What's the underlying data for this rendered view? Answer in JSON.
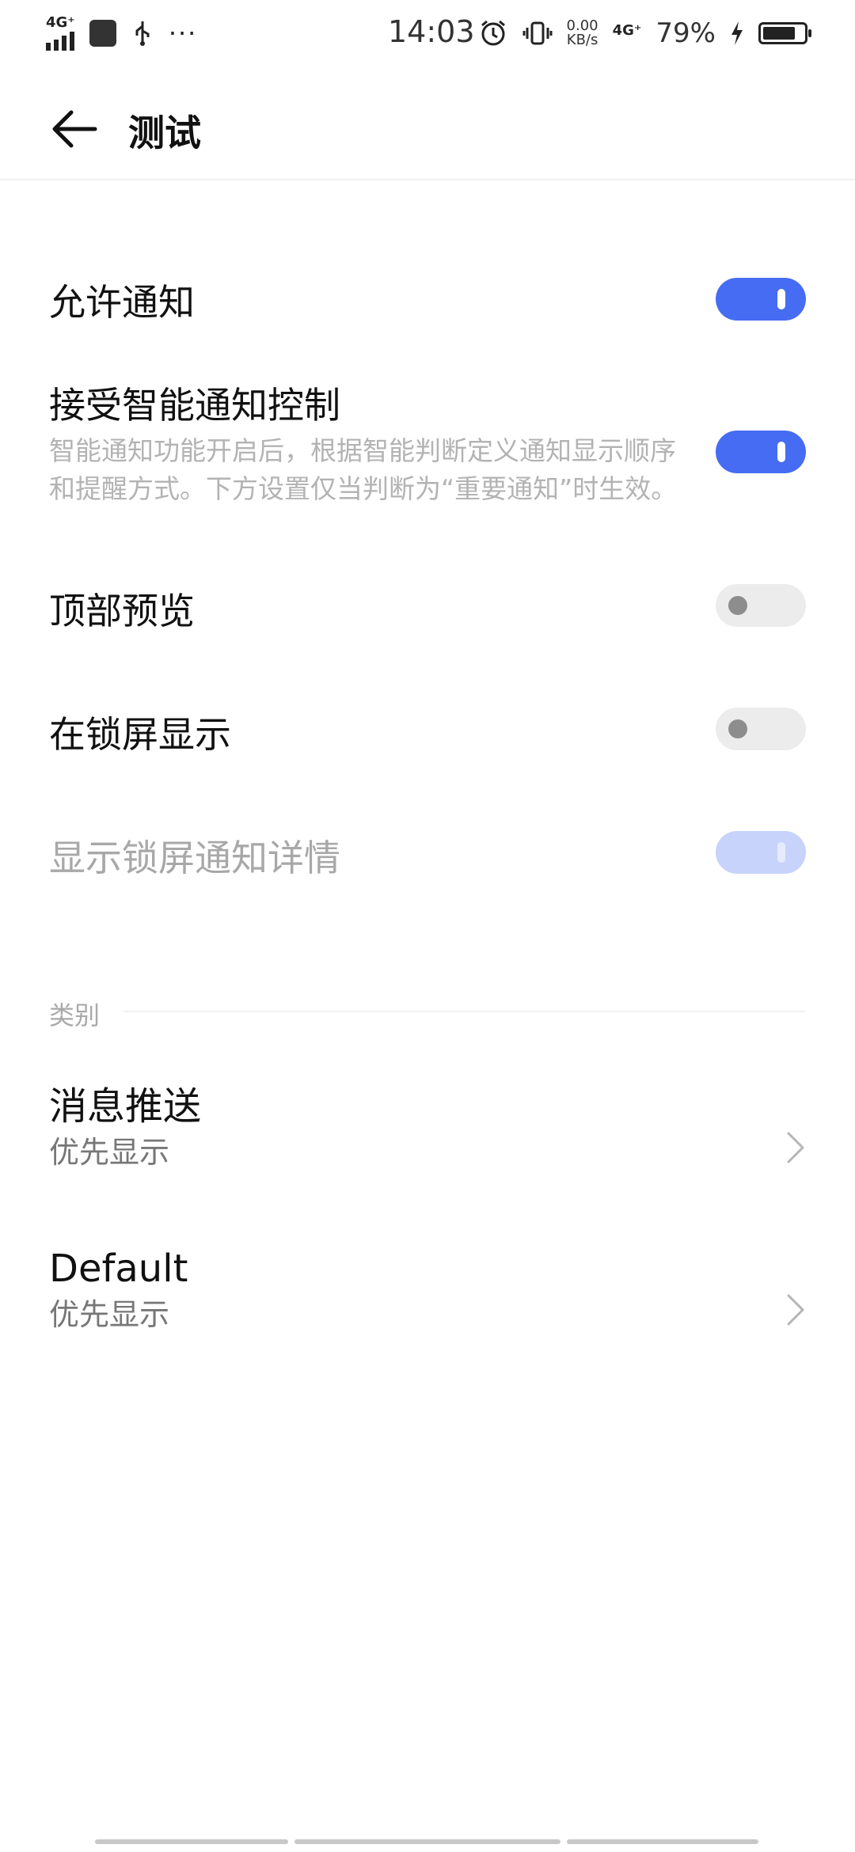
{
  "status_bar": {
    "network_left": "4G⁺",
    "dots": "···",
    "time": "14:03",
    "speed_value": "0.00",
    "speed_unit": "KB/s",
    "network_right": "4G⁺",
    "battery_percent": "79%"
  },
  "header": {
    "title": "测试"
  },
  "settings": {
    "allow_notifications": {
      "label": "允许通知",
      "enabled": true
    },
    "smart_control": {
      "label": "接受智能通知控制",
      "description": "智能通知功能开启后，根据智能判断定义通知显示顺序和提醒方式。下方设置仅当判断为“重要通知”时生效。",
      "enabled": true
    },
    "top_preview": {
      "label": "顶部预览",
      "enabled": false
    },
    "lockscreen_show": {
      "label": "在锁屏显示",
      "enabled": false
    },
    "lockscreen_details": {
      "label": "显示锁屏通知详情",
      "enabled": true,
      "disabled": true
    }
  },
  "categories": {
    "section_label": "类别",
    "items": [
      {
        "title": "消息推送",
        "subtitle": "优先显示"
      },
      {
        "title": "Default",
        "subtitle": "优先显示"
      }
    ]
  },
  "colors": {
    "accent": "#456cf2",
    "toggle_off": "#ececec",
    "toggle_disabled_on": "#c8d3fb"
  }
}
